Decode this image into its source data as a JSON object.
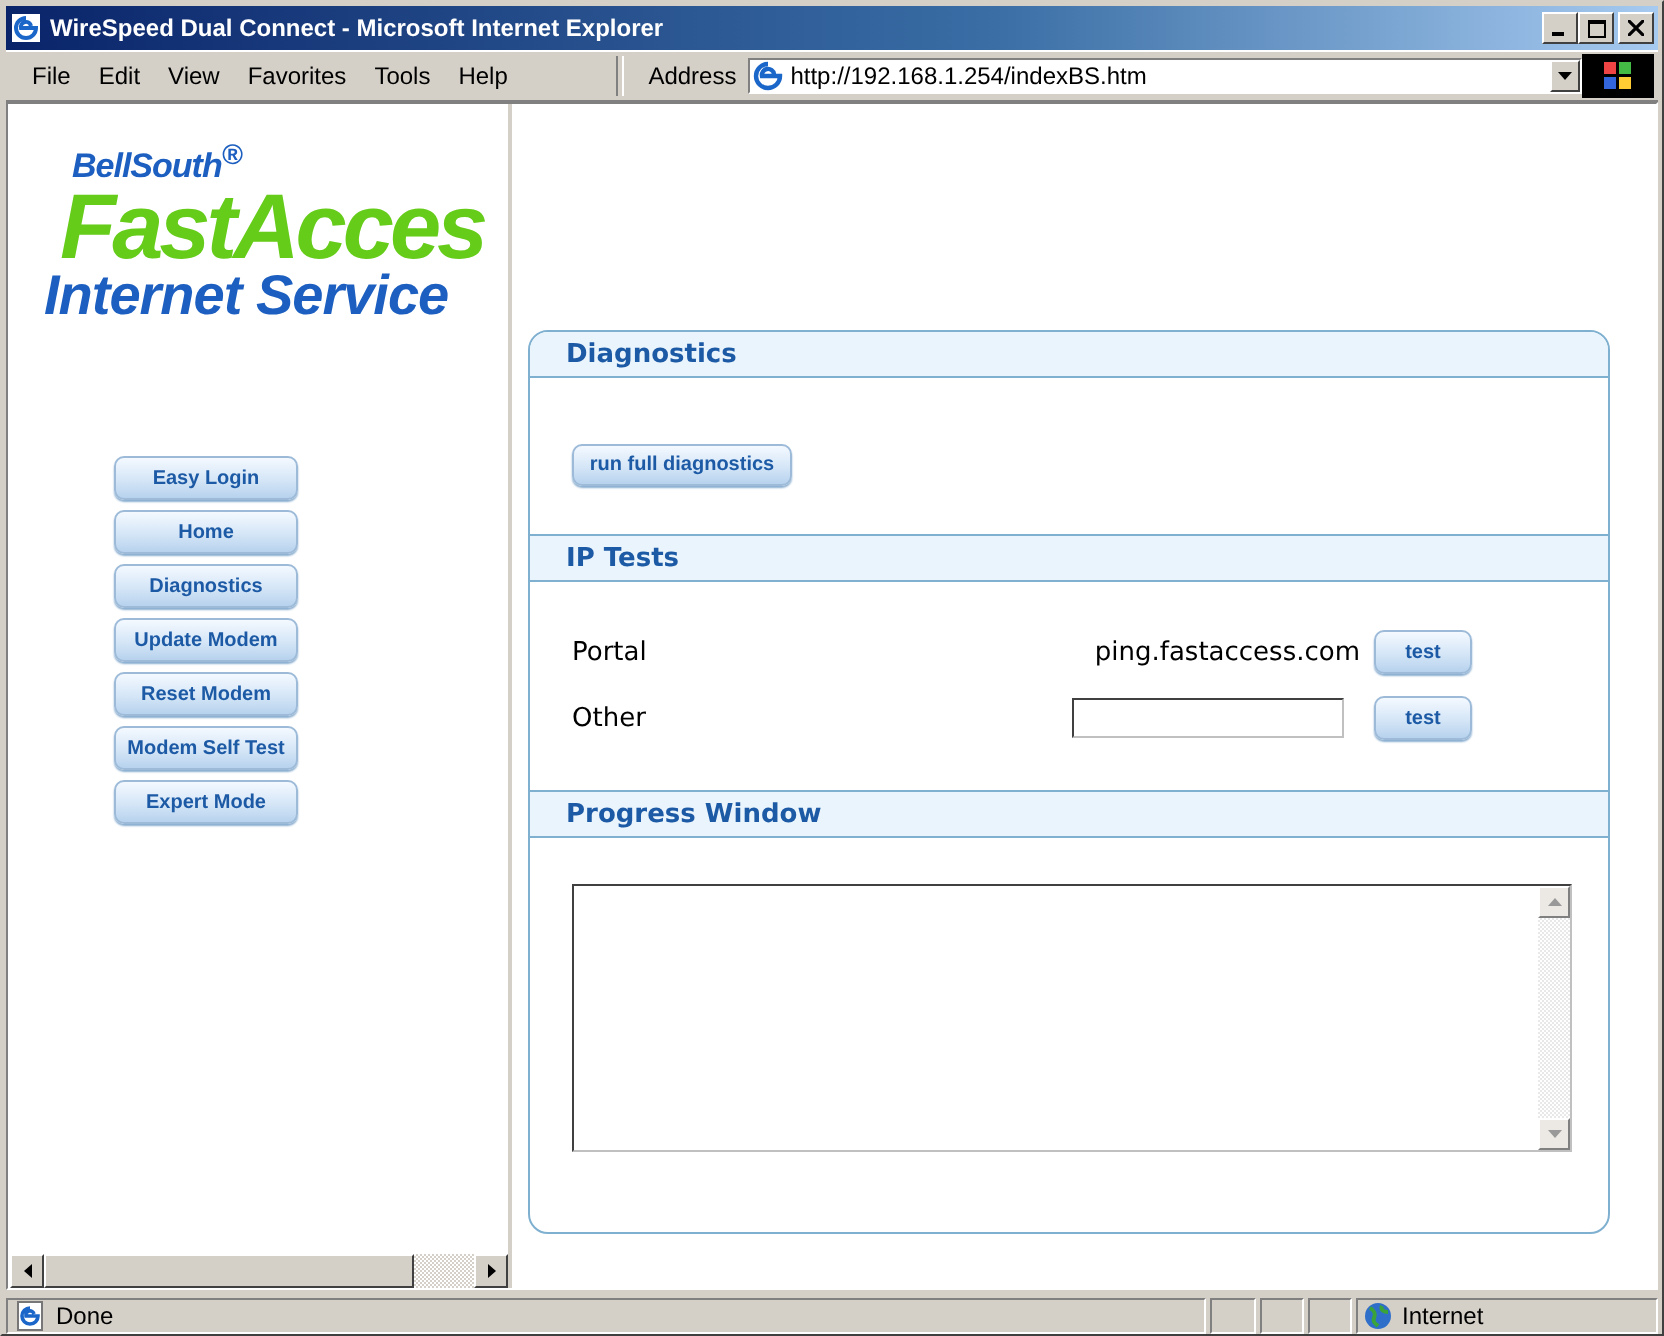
{
  "window": {
    "title": "WireSpeed Dual Connect - Microsoft Internet Explorer"
  },
  "menu": [
    "File",
    "Edit",
    "View",
    "Favorites",
    "Tools",
    "Help"
  ],
  "address": {
    "label": "Address",
    "value": "http://192.168.1.254/indexBS.htm"
  },
  "logo": {
    "brand": "BellSouth$^{®}$",
    "product": "FastAcces",
    "tagline": "Internet Service"
  },
  "nav": [
    "Easy Login",
    "Home",
    "Diagnostics",
    "Update Modem",
    "Reset Modem",
    "Modem Self Test",
    "Expert Mode"
  ],
  "sections": [
    {
      "title": "Diagnostics",
      "kind": "actions",
      "button": "run full diagnostics"
    },
    {
      "title": "IP Tests",
      "kind": "tests",
      "rows": [
        {
          "label": "Portal",
          "kind": "text",
          "value": "ping.fastaccess.com",
          "button": "test"
        },
        {
          "label": "Other",
          "kind": "input",
          "button": "test"
        }
      ]
    },
    {
      "title": "Progress Window",
      "kind": "log"
    }
  ],
  "status_bar": {
    "text": "Done",
    "zone": "Internet"
  }
}
